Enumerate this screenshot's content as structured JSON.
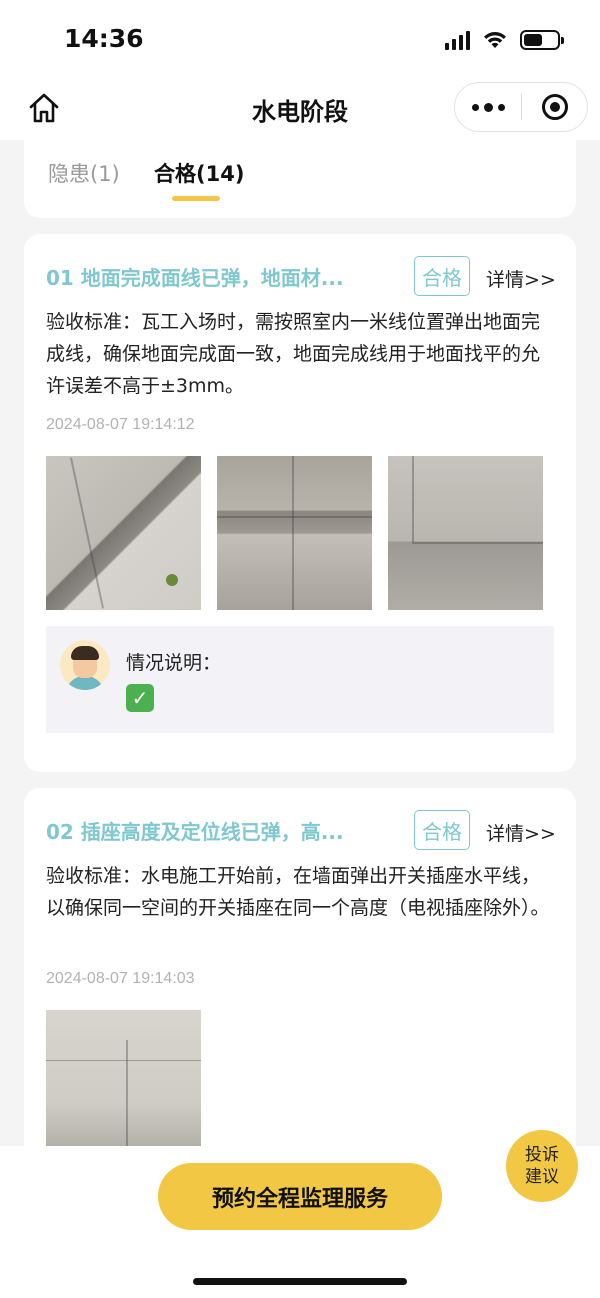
{
  "status_bar": {
    "time": "14:36",
    "battery_level": 0.55
  },
  "nav": {
    "title": "水电阶段"
  },
  "tabs": [
    {
      "label": "隐患(1)",
      "active": false
    },
    {
      "label": "合格(14)",
      "active": true
    }
  ],
  "items": [
    {
      "title": "01 地面完成面线已弹，地面材...",
      "badge": "合格",
      "detail_label": "详情>>",
      "standard": "验收标准：瓦工入场时，需按照室内一米线位置弹出地面完成线，确保地面完成面一致，地面完成线用于地面找平的允许误差不高于±3mm。",
      "timestamp": "2024-08-07 19:14:12",
      "photo_count": 3,
      "remark_label": "情况说明：",
      "remark_content": "✓"
    },
    {
      "title": "02 插座高度及定位线已弹，高...",
      "badge": "合格",
      "detail_label": "详情>>",
      "standard": "验收标准：水电施工开始前，在墙面弹出开关插座水平线，以确保同一空间的开关插座在同一个高度（电视插座除外）。",
      "timestamp": "2024-08-07 19:14:03",
      "photo_count": 1
    }
  ],
  "bottom": {
    "cta_label": "预约全程监理服务",
    "feedback_line1": "投诉",
    "feedback_line2": "建议"
  },
  "colors": {
    "accent_yellow": "#f2c744",
    "title_teal": "#7fc8cf",
    "muted_gray": "#9a9a9a",
    "check_green": "#4cb050"
  }
}
